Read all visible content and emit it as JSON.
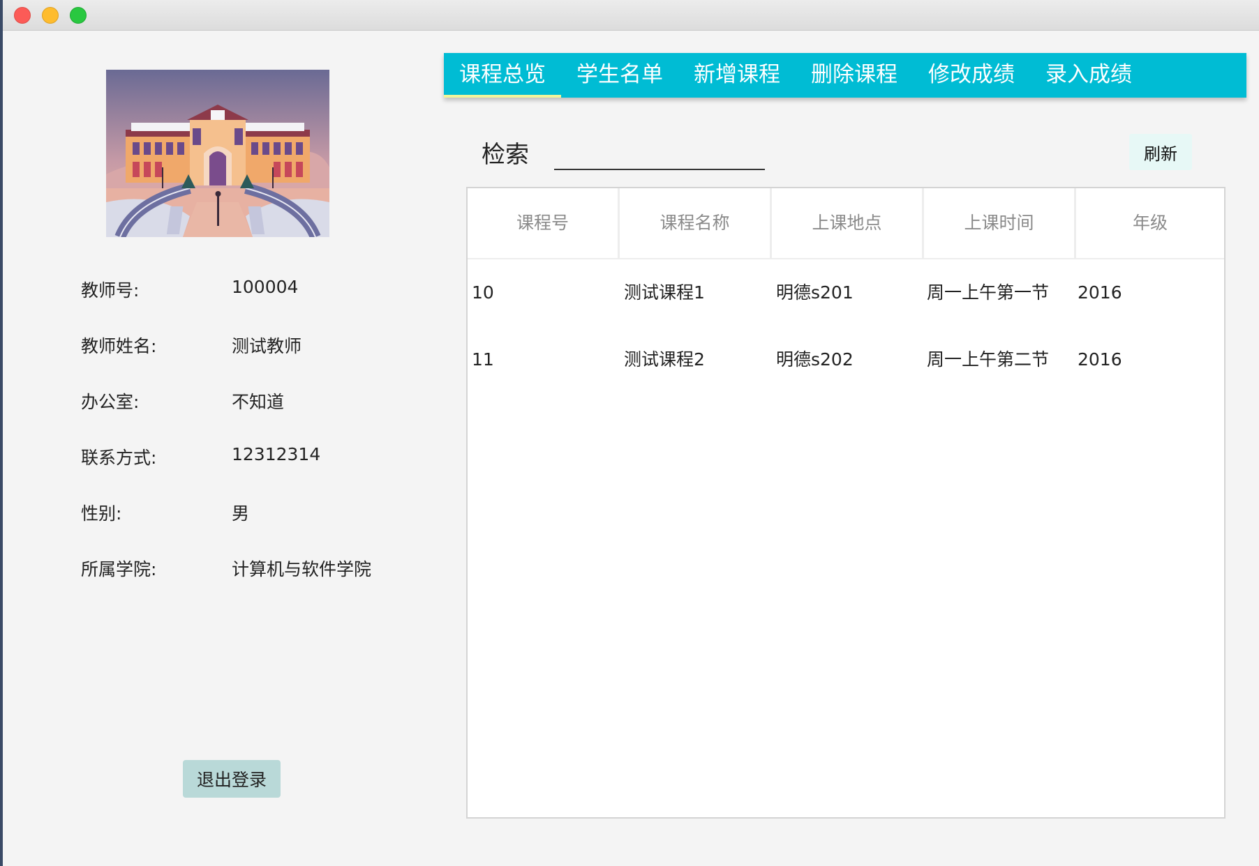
{
  "window": {
    "controls": [
      "close",
      "minimize",
      "maximize"
    ]
  },
  "teacher": {
    "fields": [
      {
        "label": "教师号:",
        "value": "100004"
      },
      {
        "label": "教师姓名:",
        "value": "测试教师"
      },
      {
        "label": "办公室:",
        "value": "不知道"
      },
      {
        "label": "联系方式:",
        "value": "12312314"
      },
      {
        "label": "性别:",
        "value": "男"
      },
      {
        "label": "所属学院:",
        "value": "计算机与软件学院"
      }
    ],
    "logout_label": "退出登录"
  },
  "tabs": [
    {
      "label": "课程总览",
      "active": true
    },
    {
      "label": "学生名单",
      "active": false
    },
    {
      "label": "新增课程",
      "active": false
    },
    {
      "label": "删除课程",
      "active": false
    },
    {
      "label": "修改成绩",
      "active": false
    },
    {
      "label": "录入成绩",
      "active": false
    }
  ],
  "search": {
    "label": "检索",
    "value": "",
    "refresh_label": "刷新"
  },
  "table": {
    "columns": [
      "课程号",
      "课程名称",
      "上课地点",
      "上课时间",
      "年级"
    ],
    "rows": [
      [
        "10",
        "测试课程1",
        "明德s201",
        "周一上午第一节",
        "2016"
      ],
      [
        "11",
        "测试课程2",
        "明德s202",
        "周一上午第二节",
        "2016"
      ]
    ]
  },
  "colors": {
    "tab_bar": "#00bcd4",
    "tab_indicator": "#f0f49a",
    "logout_button": "#b9d9d8",
    "refresh_button": "#e7f8f6"
  },
  "icons": {
    "close": "close-dot-icon",
    "minimize": "minimize-dot-icon",
    "maximize": "maximize-dot-icon",
    "campus_image": "campus-building-illustration"
  }
}
